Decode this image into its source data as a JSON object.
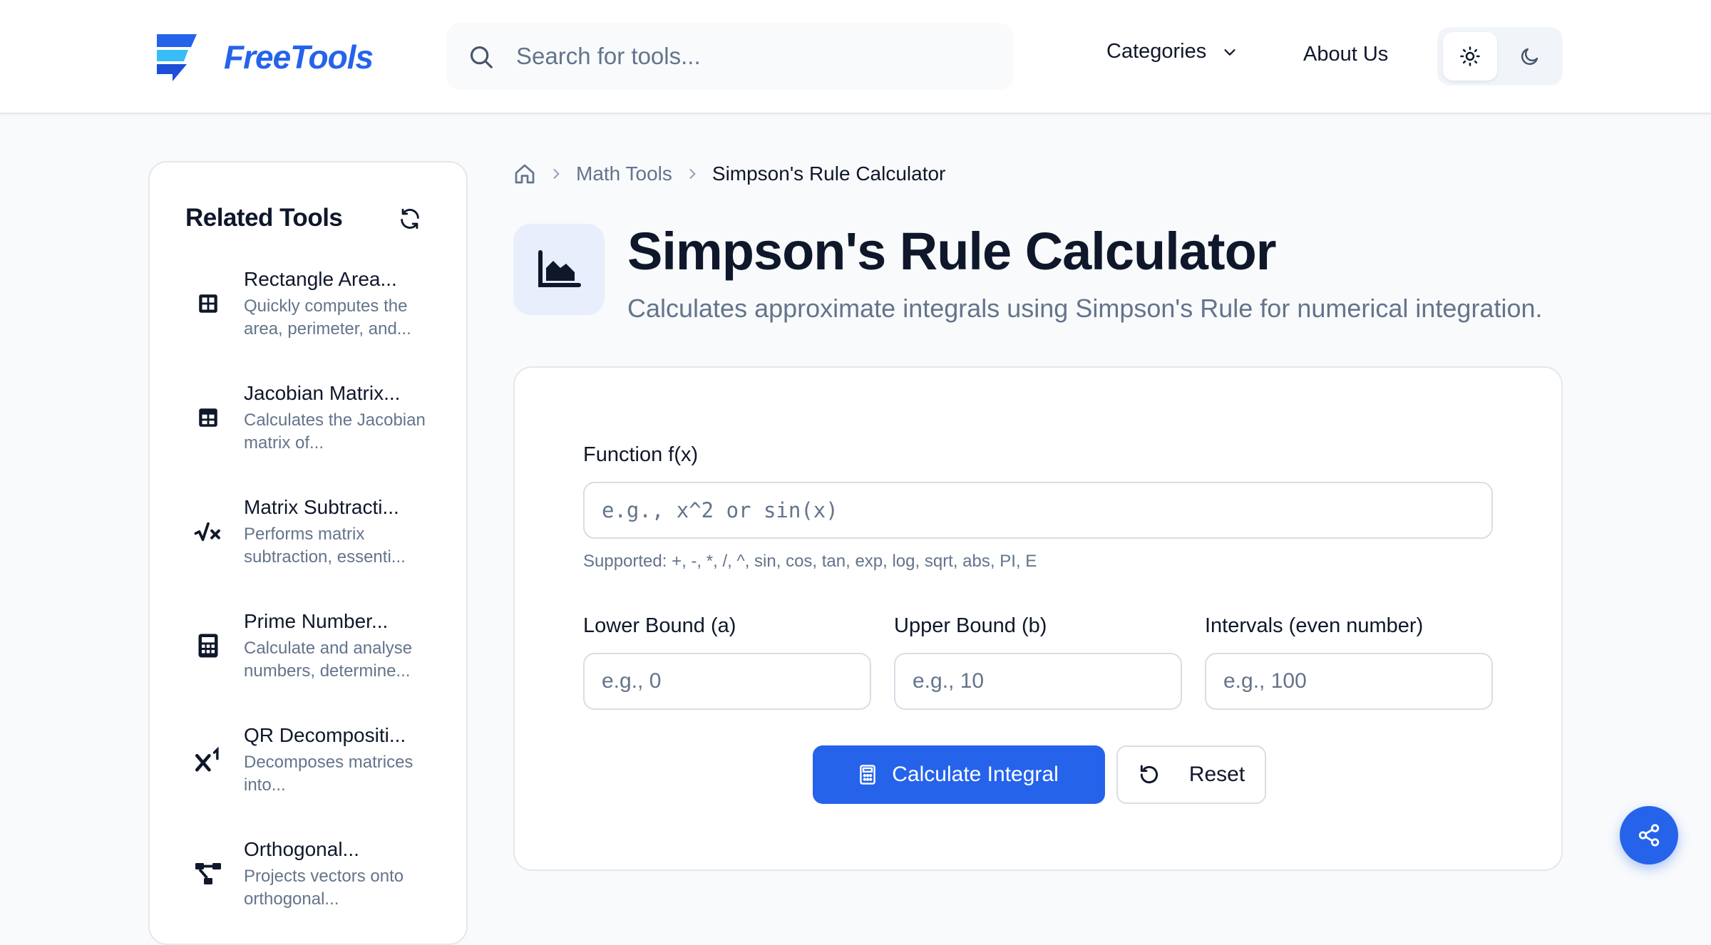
{
  "brand": {
    "name": "FreeTools",
    "accent_color": "#2563eb"
  },
  "header": {
    "search_placeholder": "Search for tools...",
    "nav": {
      "categories": "Categories",
      "about": "About Us"
    },
    "theme": {
      "light_icon": "sun-icon",
      "dark_icon": "moon-icon"
    }
  },
  "sidebar": {
    "title": "Related Tools",
    "items": [
      {
        "name": "Rectangle Area...",
        "description": "Quickly computes the area, perimeter, and...",
        "icon": "grid-icon"
      },
      {
        "name": "Jacobian Matrix...",
        "description": "Calculates the Jacobian matrix of...",
        "icon": "table-icon"
      },
      {
        "name": "Matrix Subtracti...",
        "description": "Performs matrix subtraction, essenti...",
        "icon": "square-root-icon"
      },
      {
        "name": "Prime Number...",
        "description": "Calculate and analyse numbers, determine...",
        "icon": "calculator-icon"
      },
      {
        "name": "QR Decompositi...",
        "description": "Decomposes matrices into...",
        "icon": "superscript-icon"
      },
      {
        "name": "Orthogonal...",
        "description": "Projects vectors onto orthogonal...",
        "icon": "diagram-project-icon"
      }
    ]
  },
  "breadcrumb": {
    "home_icon": "home-icon",
    "category": "Math Tools",
    "current": "Simpson's Rule Calculator"
  },
  "page": {
    "title": "Simpson's Rule Calculator",
    "subtitle": "Calculates approximate integrals using Simpson's Rule for numerical integration.",
    "icon": "area-chart-icon"
  },
  "form": {
    "function_label": "Function f(x)",
    "function_placeholder": "e.g., x^2 or sin(x)",
    "supported_hint": "Supported: +, -, *, /, ^, sin, cos, tan, exp, log, sqrt, abs, PI, E",
    "lower_label": "Lower Bound (a)",
    "lower_placeholder": "e.g., 0",
    "upper_label": "Upper Bound (b)",
    "upper_placeholder": "e.g., 10",
    "intervals_label": "Intervals (even number)",
    "intervals_placeholder": "e.g., 100",
    "calculate_label": "Calculate Integral",
    "reset_label": "Reset"
  },
  "share": {
    "icon": "share-icon"
  }
}
